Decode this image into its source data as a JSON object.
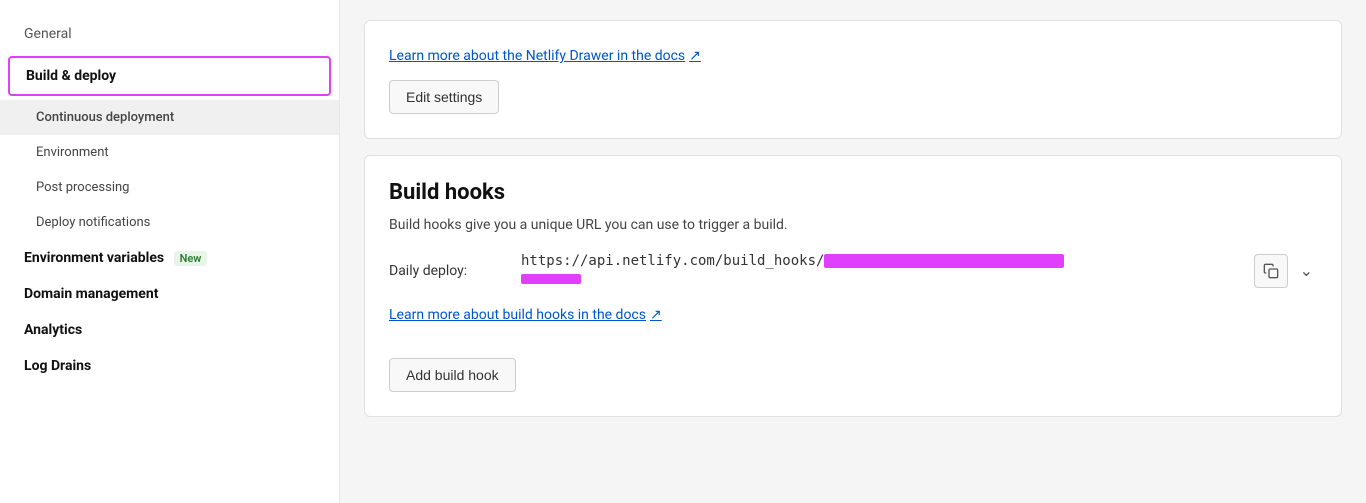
{
  "sidebar": {
    "items": [
      {
        "id": "general",
        "label": "General",
        "type": "top-level",
        "active": false
      },
      {
        "id": "build-deploy",
        "label": "Build & deploy",
        "type": "top-level",
        "active": true
      },
      {
        "id": "continuous-deployment",
        "label": "Continuous deployment",
        "type": "sub",
        "active": true
      },
      {
        "id": "environment",
        "label": "Environment",
        "type": "sub",
        "active": false
      },
      {
        "id": "post-processing",
        "label": "Post processing",
        "type": "sub",
        "active": false
      },
      {
        "id": "deploy-notifications",
        "label": "Deploy notifications",
        "type": "sub",
        "active": false
      },
      {
        "id": "environment-variables",
        "label": "Environment variables",
        "type": "section",
        "badge": "New",
        "active": false
      },
      {
        "id": "domain-management",
        "label": "Domain management",
        "type": "section",
        "active": false
      },
      {
        "id": "analytics",
        "label": "Analytics",
        "type": "section",
        "active": false
      },
      {
        "id": "log-drains",
        "label": "Log Drains",
        "type": "section",
        "active": false
      }
    ]
  },
  "top_card": {
    "link_text": "Learn more about the Netlify Drawer in the docs",
    "link_icon": "↗",
    "edit_button_label": "Edit settings"
  },
  "build_hooks_card": {
    "title": "Build hooks",
    "description": "Build hooks give you a unique URL you can use to trigger a build.",
    "daily_deploy_label": "Daily deploy:",
    "url_prefix": "https://api.netlify.com/build_hooks/",
    "docs_link_text": "Learn more about build hooks in the docs",
    "docs_link_icon": "↗",
    "add_button_label": "Add build hook"
  }
}
